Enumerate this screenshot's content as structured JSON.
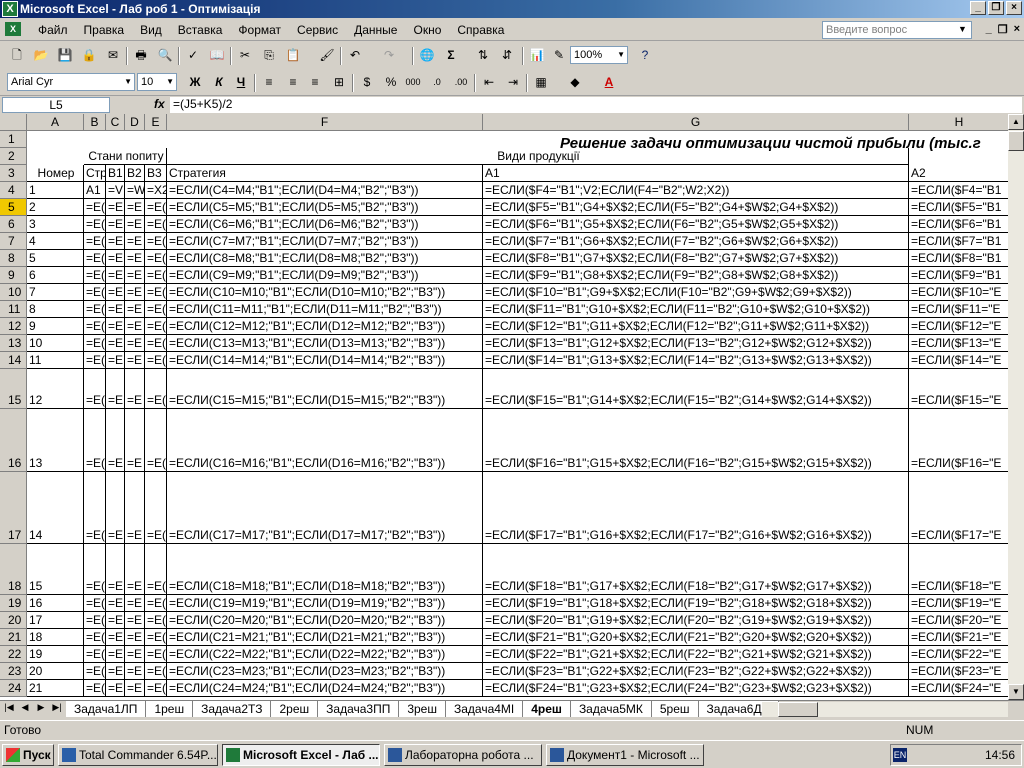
{
  "window": {
    "title": "Microsoft Excel - Лаб роб 1 - Оптимізація",
    "app_icon": "X"
  },
  "menu": [
    "Файл",
    "Правка",
    "Вид",
    "Вставка",
    "Формат",
    "Сервис",
    "Данные",
    "Окно",
    "Справка"
  ],
  "help_placeholder": "Введите вопрос",
  "toolbar": {
    "zoom": "100%",
    "font_name": "Arial Cyr",
    "font_size": "10"
  },
  "formula_bar": {
    "cell_ref": "L5",
    "fx": "fx",
    "formula": "=(J5+K5)/2"
  },
  "columns": [
    "A",
    "B",
    "C",
    "D",
    "E",
    "F",
    "G",
    "H"
  ],
  "header_cells": {
    "title": "Решение задачи оптимизации чистой прибыли (тыс.г",
    "b2": "Стани попиту",
    "g2": "Види продукції",
    "a3": "Номер",
    "b3": "Стр",
    "c3": "В1",
    "d3": "В2",
    "e3": "В3",
    "f3": "Стратегия",
    "g3": "А1",
    "h3": "А2"
  },
  "rows": [
    {
      "num": "4",
      "a": "1",
      "b": "А1",
      "c": "=V",
      "d": "=W",
      "e": "=X2",
      "f": "=ЕСЛИ(C4=M4;\"В1\";ЕСЛИ(D4=M4;\"В2\";\"В3\"))",
      "g": "=ЕСЛИ($F4=\"В1\";V2;ЕСЛИ(F4=\"В2\";W2;X2))",
      "h": "=ЕСЛИ($F4=\"В1"
    },
    {
      "num": "5",
      "a": "2",
      "b": "=Е(",
      "c": "=Е",
      "d": "=Е",
      "e": "=Е(",
      "f": "=ЕСЛИ(C5=M5;\"В1\";ЕСЛИ(D5=M5;\"В2\";\"В3\"))",
      "g": "=ЕСЛИ($F5=\"В1\";G4+$X$2;ЕСЛИ(F5=\"В2\";G4+$W$2;G4+$X$2))",
      "h": "=ЕСЛИ($F5=\"В1"
    },
    {
      "num": "6",
      "a": "3",
      "b": "=Е(",
      "c": "=Е",
      "d": "=Е",
      "e": "=Е(",
      "f": "=ЕСЛИ(C6=M6;\"В1\";ЕСЛИ(D6=M6;\"В2\";\"В3\"))",
      "g": "=ЕСЛИ($F6=\"В1\";G5+$X$2;ЕСЛИ(F6=\"В2\";G5+$W$2;G5+$X$2))",
      "h": "=ЕСЛИ($F6=\"В1"
    },
    {
      "num": "7",
      "a": "4",
      "b": "=Е(",
      "c": "=Е",
      "d": "=Е",
      "e": "=Е(",
      "f": "=ЕСЛИ(C7=M7;\"В1\";ЕСЛИ(D7=M7;\"В2\";\"В3\"))",
      "g": "=ЕСЛИ($F7=\"В1\";G6+$X$2;ЕСЛИ(F7=\"В2\";G6+$W$2;G6+$X$2))",
      "h": "=ЕСЛИ($F7=\"В1"
    },
    {
      "num": "8",
      "a": "5",
      "b": "=Е(",
      "c": "=Е",
      "d": "=Е",
      "e": "=Е(",
      "f": "=ЕСЛИ(C8=M8;\"В1\";ЕСЛИ(D8=M8;\"В2\";\"В3\"))",
      "g": "=ЕСЛИ($F8=\"В1\";G7+$X$2;ЕСЛИ(F8=\"В2\";G7+$W$2;G7+$X$2))",
      "h": "=ЕСЛИ($F8=\"В1"
    },
    {
      "num": "9",
      "a": "6",
      "b": "=Е(",
      "c": "=Е",
      "d": "=Е",
      "e": "=Е(",
      "f": "=ЕСЛИ(C9=M9;\"В1\";ЕСЛИ(D9=M9;\"В2\";\"В3\"))",
      "g": "=ЕСЛИ($F9=\"В1\";G8+$X$2;ЕСЛИ(F9=\"В2\";G8+$W$2;G8+$X$2))",
      "h": "=ЕСЛИ($F9=\"В1"
    },
    {
      "num": "10",
      "a": "7",
      "b": "=Е(",
      "c": "=Е",
      "d": "=Е",
      "e": "=Е(",
      "f": "=ЕСЛИ(C10=M10;\"В1\";ЕСЛИ(D10=M10;\"В2\";\"В3\"))",
      "g": "=ЕСЛИ($F10=\"В1\";G9+$X$2;ЕСЛИ(F10=\"В2\";G9+$W$2;G9+$X$2))",
      "h": "=ЕСЛИ($F10=\"Е"
    },
    {
      "num": "11",
      "a": "8",
      "b": "=Е(",
      "c": "=Е",
      "d": "=Е",
      "e": "=Е(",
      "f": "=ЕСЛИ(C11=M11;\"В1\";ЕСЛИ(D11=M11;\"В2\";\"В3\"))",
      "g": "=ЕСЛИ($F11=\"В1\";G10+$X$2;ЕСЛИ(F11=\"В2\";G10+$W$2;G10+$X$2))",
      "h": "=ЕСЛИ($F11=\"Е"
    },
    {
      "num": "12",
      "a": "9",
      "b": "=Е(",
      "c": "=Е",
      "d": "=Е",
      "e": "=Е(",
      "f": "=ЕСЛИ(C12=M12;\"В1\";ЕСЛИ(D12=M12;\"В2\";\"В3\"))",
      "g": "=ЕСЛИ($F12=\"В1\";G11+$X$2;ЕСЛИ(F12=\"В2\";G11+$W$2;G11+$X$2))",
      "h": "=ЕСЛИ($F12=\"Е"
    },
    {
      "num": "13",
      "a": "10",
      "b": "=Е(",
      "c": "=Е",
      "d": "=Е",
      "e": "=Е(",
      "f": "=ЕСЛИ(C13=M13;\"В1\";ЕСЛИ(D13=M13;\"В2\";\"В3\"))",
      "g": "=ЕСЛИ($F13=\"В1\";G12+$X$2;ЕСЛИ(F13=\"В2\";G12+$W$2;G12+$X$2))",
      "h": "=ЕСЛИ($F13=\"Е"
    },
    {
      "num": "14",
      "a": "11",
      "b": "=Е(",
      "c": "=Е",
      "d": "=Е",
      "e": "=Е(",
      "f": "=ЕСЛИ(C14=M14;\"В1\";ЕСЛИ(D14=M14;\"В2\";\"В3\"))",
      "g": "=ЕСЛИ($F14=\"В1\";G13+$X$2;ЕСЛИ(F14=\"В2\";G13+$W$2;G13+$X$2))",
      "h": "=ЕСЛИ($F14=\"Е"
    },
    {
      "num": "15",
      "a": "12",
      "b": "=Е(",
      "c": "=Е",
      "d": "=Е",
      "e": "=Е(",
      "f": "=ЕСЛИ(C15=M15;\"В1\";ЕСЛИ(D15=M15;\"В2\";\"В3\"))",
      "g": "=ЕСЛИ($F15=\"В1\";G14+$X$2;ЕСЛИ(F15=\"В2\";G14+$W$2;G14+$X$2))",
      "h": "=ЕСЛИ($F15=\"Е"
    },
    {
      "num": "16",
      "a": "13",
      "b": "=Е(",
      "c": "=Е",
      "d": "=Е",
      "e": "=Е(",
      "f": "=ЕСЛИ(C16=M16;\"В1\";ЕСЛИ(D16=M16;\"В2\";\"В3\"))",
      "g": "=ЕСЛИ($F16=\"В1\";G15+$X$2;ЕСЛИ(F16=\"В2\";G15+$W$2;G15+$X$2))",
      "h": "=ЕСЛИ($F16=\"Е"
    },
    {
      "num": "17",
      "a": "14",
      "b": "=Е(",
      "c": "=Е",
      "d": "=Е",
      "e": "=Е(",
      "f": "=ЕСЛИ(C17=M17;\"В1\";ЕСЛИ(D17=M17;\"В2\";\"В3\"))",
      "g": "=ЕСЛИ($F17=\"В1\";G16+$X$2;ЕСЛИ(F17=\"В2\";G16+$W$2;G16+$X$2))",
      "h": "=ЕСЛИ($F17=\"Е"
    },
    {
      "num": "18",
      "a": "15",
      "b": "=Е(",
      "c": "=Е",
      "d": "=Е",
      "e": "=Е(",
      "f": "=ЕСЛИ(C18=M18;\"В1\";ЕСЛИ(D18=M18;\"В2\";\"В3\"))",
      "g": "=ЕСЛИ($F18=\"В1\";G17+$X$2;ЕСЛИ(F18=\"В2\";G17+$W$2;G17+$X$2))",
      "h": "=ЕСЛИ($F18=\"Е"
    },
    {
      "num": "19",
      "a": "16",
      "b": "=Е(",
      "c": "=Е",
      "d": "=Е",
      "e": "=Е(",
      "f": "=ЕСЛИ(C19=M19;\"В1\";ЕСЛИ(D19=M19;\"В2\";\"В3\"))",
      "g": "=ЕСЛИ($F19=\"В1\";G18+$X$2;ЕСЛИ(F19=\"В2\";G18+$W$2;G18+$X$2))",
      "h": "=ЕСЛИ($F19=\"Е"
    },
    {
      "num": "20",
      "a": "17",
      "b": "=Е(",
      "c": "=Е",
      "d": "=Е",
      "e": "=Е(",
      "f": "=ЕСЛИ(C20=M20;\"В1\";ЕСЛИ(D20=M20;\"В2\";\"В3\"))",
      "g": "=ЕСЛИ($F20=\"В1\";G19+$X$2;ЕСЛИ(F20=\"В2\";G19+$W$2;G19+$X$2))",
      "h": "=ЕСЛИ($F20=\"Е"
    },
    {
      "num": "21",
      "a": "18",
      "b": "=Е(",
      "c": "=Е",
      "d": "=Е",
      "e": "=Е(",
      "f": "=ЕСЛИ(C21=M21;\"В1\";ЕСЛИ(D21=M21;\"В2\";\"В3\"))",
      "g": "=ЕСЛИ($F21=\"В1\";G20+$X$2;ЕСЛИ(F21=\"В2\";G20+$W$2;G20+$X$2))",
      "h": "=ЕСЛИ($F21=\"Е"
    },
    {
      "num": "22",
      "a": "19",
      "b": "=Е(",
      "c": "=Е",
      "d": "=Е",
      "e": "=Е(",
      "f": "=ЕСЛИ(C22=M22;\"В1\";ЕСЛИ(D22=M22;\"В2\";\"В3\"))",
      "g": "=ЕСЛИ($F22=\"В1\";G21+$X$2;ЕСЛИ(F22=\"В2\";G21+$W$2;G21+$X$2))",
      "h": "=ЕСЛИ($F22=\"Е"
    },
    {
      "num": "23",
      "a": "20",
      "b": "=Е(",
      "c": "=Е",
      "d": "=Е",
      "e": "=Е(",
      "f": "=ЕСЛИ(C23=M23;\"В1\";ЕСЛИ(D23=M23;\"В2\";\"В3\"))",
      "g": "=ЕСЛИ($F23=\"В1\";G22+$X$2;ЕСЛИ(F23=\"В2\";G22+$W$2;G22+$X$2))",
      "h": "=ЕСЛИ($F23=\"Е"
    },
    {
      "num": "24",
      "a": "21",
      "b": "=Е(",
      "c": "=Е",
      "d": "=Е",
      "e": "=Е(",
      "f": "=ЕСЛИ(C24=M24;\"В1\";ЕСЛИ(D24=M24;\"В2\";\"В3\"))",
      "g": "=ЕСЛИ($F24=\"В1\";G23+$X$2;ЕСЛИ(F24=\"В2\";G23+$W$2;G23+$X$2))",
      "h": "=ЕСЛИ($F24=\"Е"
    }
  ],
  "sheet_tabs": [
    "Задача1ЛП",
    "1реш",
    "Задача2ТЗ",
    "2реш",
    "Задача3ПП",
    "3реш",
    "Задача4МІ",
    "4реш",
    "Задача5МК",
    "5реш",
    "Задача6ДП"
  ],
  "active_tab": "4реш",
  "status": {
    "text": "Готово",
    "num": "NUM"
  },
  "taskbar": {
    "start": "Пуск",
    "buttons": [
      "Total Commander 6.54P...",
      "Microsoft Excel - Лаб ...",
      "Лабораторна робота ...",
      "Документ1 - Microsoft ..."
    ],
    "lang": "EN",
    "clock": "14:56"
  }
}
